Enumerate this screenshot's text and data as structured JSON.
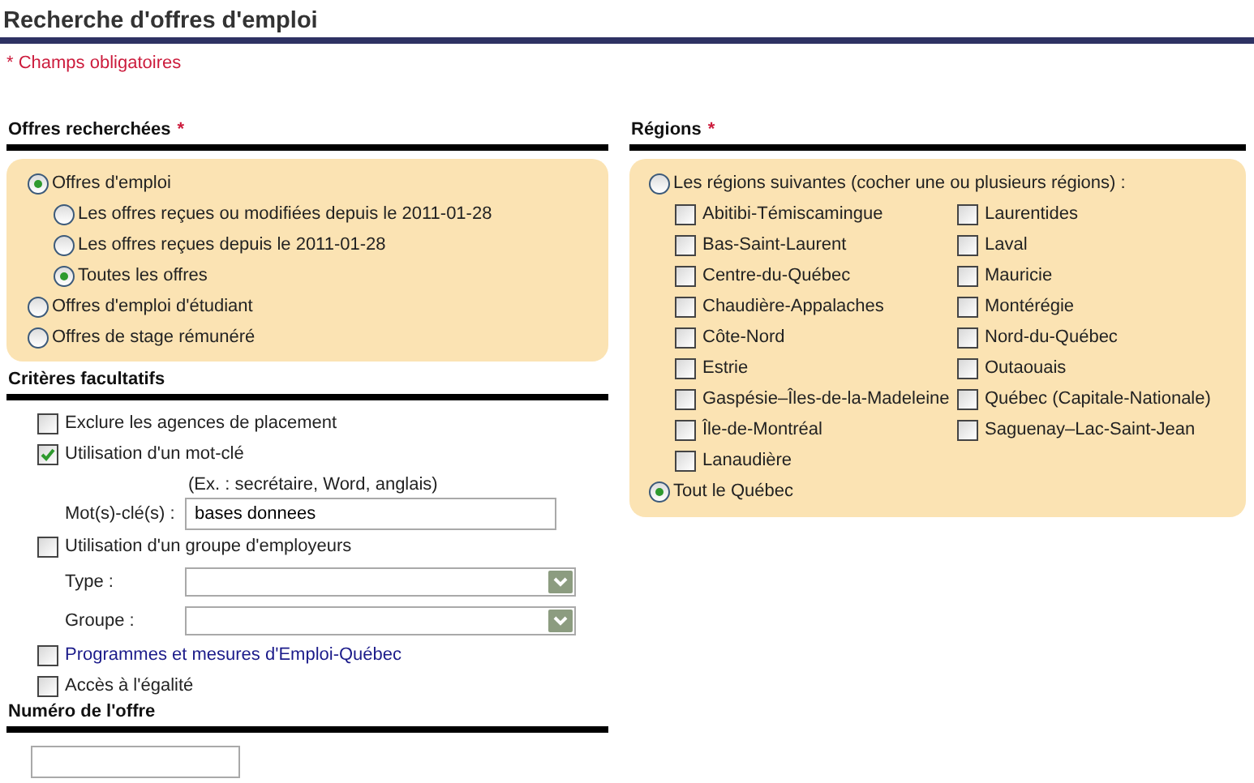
{
  "title": "Recherche d'offres d'emploi",
  "required_note": {
    "mark": "*",
    "text": "Champs obligatoires"
  },
  "offers": {
    "heading": "Offres recherchées",
    "required_mark": "*",
    "options": [
      {
        "label": "Offres d'emploi",
        "selected": true,
        "children": [
          {
            "label": "Les offres reçues ou modifiées depuis le 2011-01-28",
            "selected": false
          },
          {
            "label": "Les offres reçues depuis le 2011-01-28",
            "selected": false
          },
          {
            "label": "Toutes les offres",
            "selected": true
          }
        ]
      },
      {
        "label": "Offres d'emploi d'étudiant",
        "selected": false
      },
      {
        "label": "Offres de stage rémunéré",
        "selected": false
      }
    ]
  },
  "criteria": {
    "heading": "Critères facultatifs",
    "items": [
      {
        "kind": "checkbox",
        "label": "Exclure les agences de placement",
        "checked": false
      },
      {
        "kind": "checkbox",
        "label": "Utilisation d'un mot-clé",
        "checked": true
      },
      {
        "kind": "text",
        "hint": "(Ex. : secrétaire, Word, anglais)",
        "label": "Mot(s)-clé(s) :",
        "value": "bases donnees"
      },
      {
        "kind": "checkbox",
        "label": "Utilisation d'un groupe d'employeurs",
        "checked": false
      },
      {
        "kind": "select",
        "label": "Type :"
      },
      {
        "kind": "select",
        "label": "Groupe :"
      },
      {
        "kind": "link",
        "label": "Programmes et mesures d'Emploi-Québec",
        "checked": false
      },
      {
        "kind": "checkbox",
        "label": "Accès à l'égalité",
        "checked": false
      }
    ]
  },
  "offer_number": {
    "heading": "Numéro de l'offre"
  },
  "regions": {
    "heading": "Régions",
    "required_mark": "*",
    "options": [
      {
        "label": "Les régions suivantes (cocher une ou plusieurs régions) :",
        "selected": false,
        "regions": [
          {
            "label": "Abitibi-Témiscamingue",
            "checked": false
          },
          {
            "label": "Bas-Saint-Laurent",
            "checked": false
          },
          {
            "label": "Centre-du-Québec",
            "checked": false
          },
          {
            "label": "Chaudière-Appalaches",
            "checked": false
          },
          {
            "label": "Côte-Nord",
            "checked": false
          },
          {
            "label": "Estrie",
            "checked": false
          },
          {
            "label": "Gaspésie–Îles-de-la-Madeleine",
            "checked": false
          },
          {
            "label": "Île-de-Montréal",
            "checked": false
          },
          {
            "label": "Lanaudière",
            "checked": false
          },
          {
            "label": "Laurentides",
            "checked": false
          },
          {
            "label": "Laval",
            "checked": false
          },
          {
            "label": "Mauricie",
            "checked": false
          },
          {
            "label": "Montérégie",
            "checked": false
          },
          {
            "label": "Nord-du-Québec",
            "checked": false
          },
          {
            "label": "Outaouais",
            "checked": false
          },
          {
            "label": "Québec (Capitale-Nationale)",
            "checked": false
          },
          {
            "label": "Saguenay–Lac-Saint-Jean",
            "checked": false
          }
        ]
      },
      {
        "label": "Tout le Québec",
        "selected": true
      }
    ]
  }
}
